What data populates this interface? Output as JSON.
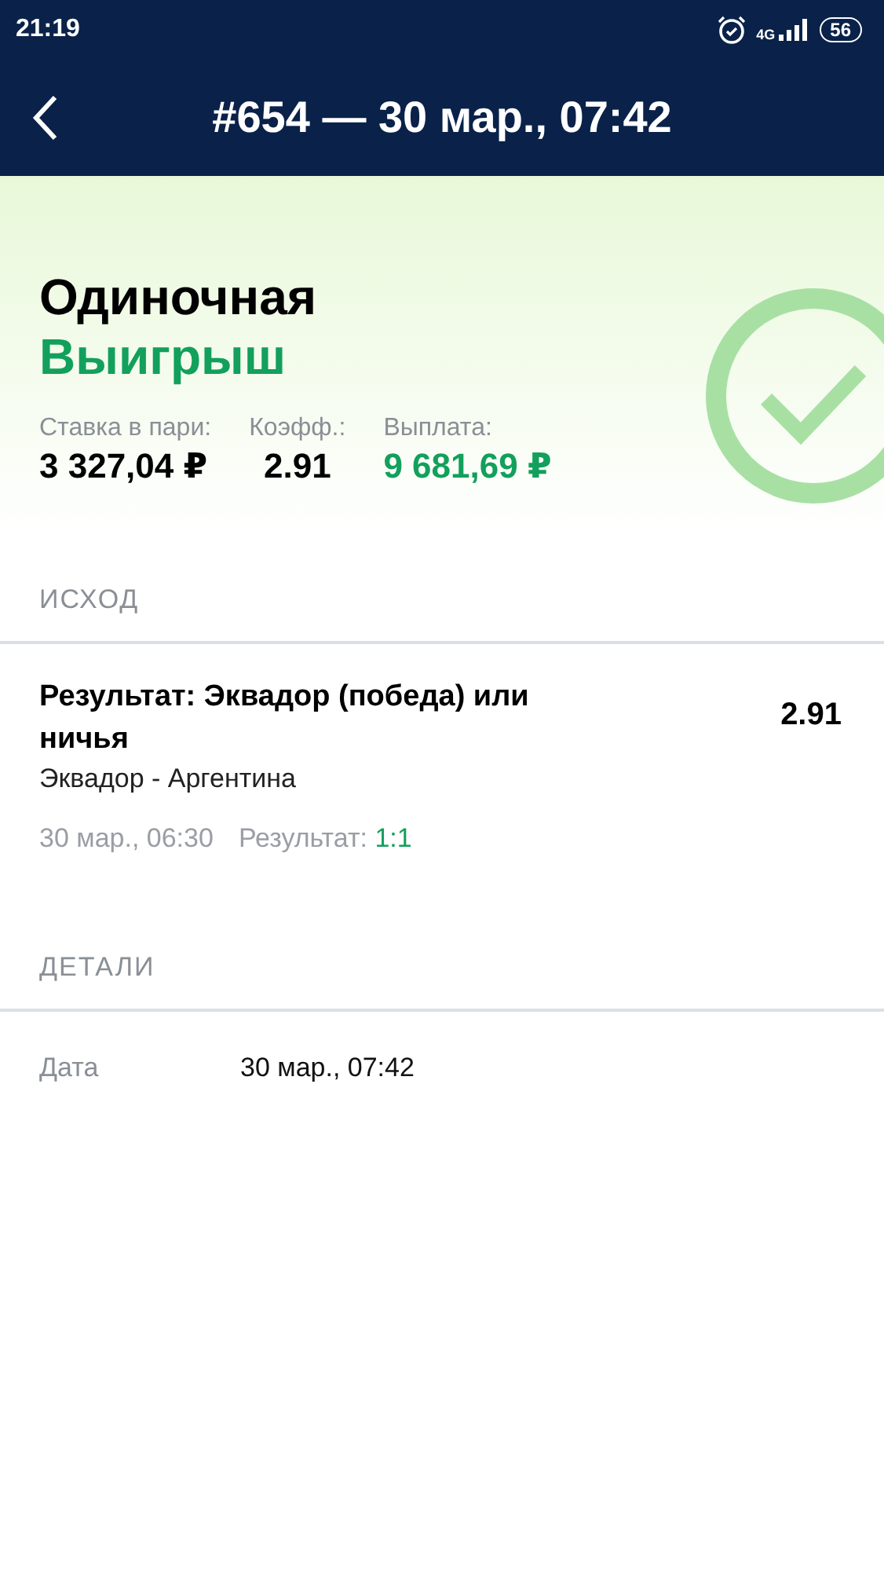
{
  "status_bar": {
    "time": "21:19",
    "network": "4G",
    "battery": "56"
  },
  "header": {
    "title": "#654 — 30 мар., 07:42"
  },
  "summary": {
    "type": "Одиночная",
    "result": {
      "label": "Выигрыш",
      "kind": "won"
    },
    "stats": [
      {
        "label": "Ставка в пари:",
        "value": "3 327,04 ₽",
        "kind": "plain"
      },
      {
        "label": "Коэфф.:",
        "value": "2.91",
        "kind": "plain"
      },
      {
        "label": "Выплата:",
        "value": "9 681,69 ₽",
        "kind": "won"
      }
    ]
  },
  "outcome_section": {
    "heading": "ИСХОД",
    "items": [
      {
        "selection": "Результат: Эквадор (победа) или ничья",
        "event": "Эквадор - Аргентина",
        "odds": "2.91",
        "start": "30 мар., 06:30",
        "result_label": "Результат:",
        "score": "1:1"
      }
    ]
  },
  "details_section": {
    "heading": "ДЕТАЛИ",
    "rows": [
      {
        "label": "Дата",
        "value": "30 мар., 07:42"
      }
    ]
  }
}
